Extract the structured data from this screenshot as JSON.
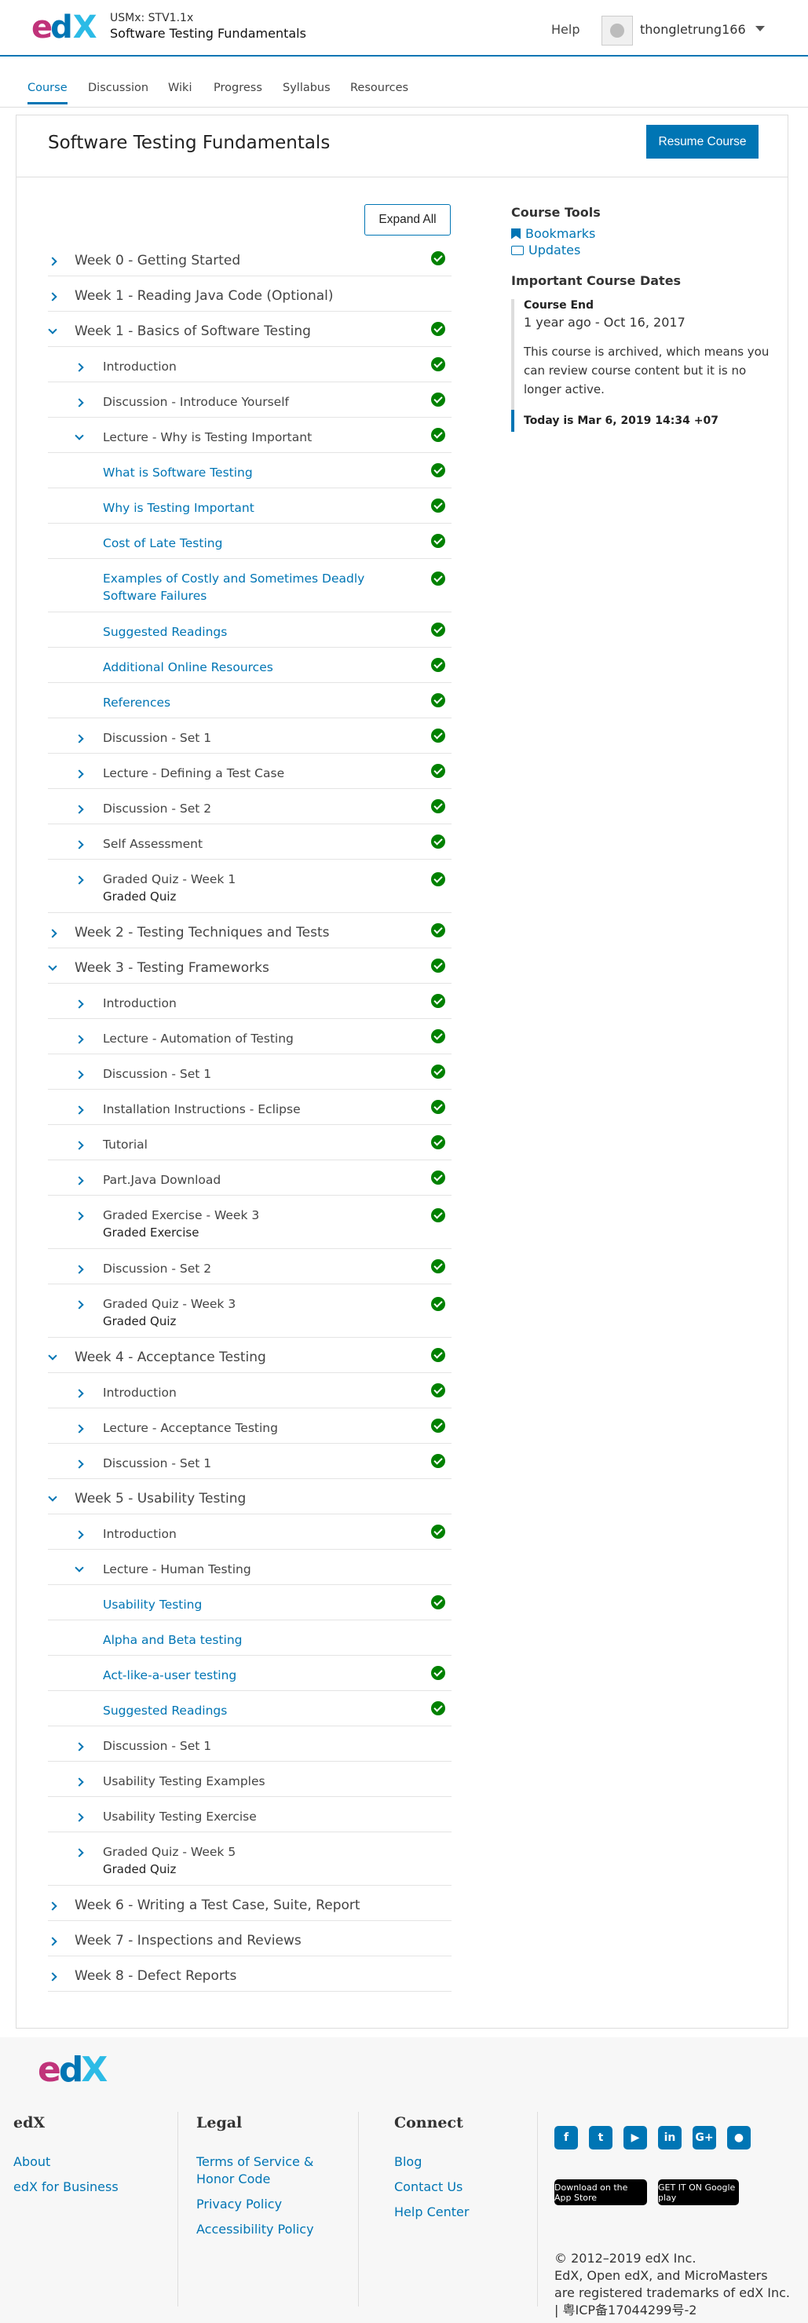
{
  "header": {
    "course_org": "USMx: STV1.1x",
    "course_title": "Software Testing Fundamentals",
    "help": "Help",
    "username": "thongletrung166"
  },
  "tabs": [
    "Course",
    "Discussion",
    "Wiki",
    "Progress",
    "Syllabus",
    "Resources"
  ],
  "main": {
    "title": "Software Testing Fundamentals",
    "resume": "Resume Course",
    "expand_all": "Expand All"
  },
  "outline": [
    {
      "text": "Week 0 - Getting Started",
      "level": 0,
      "icon": "chevron-right",
      "link": false,
      "checked": true
    },
    {
      "text": "Week 1 - Reading Java Code (Optional)",
      "level": 0,
      "icon": "chevron-right",
      "link": false,
      "checked": false
    },
    {
      "text": "Week 1 - Basics of Software Testing",
      "level": 0,
      "icon": "chevron-down",
      "link": false,
      "checked": true
    },
    {
      "text": "Introduction",
      "level": 1,
      "icon": "chevron-right",
      "link": false,
      "checked": true
    },
    {
      "text": "Discussion - Introduce Yourself",
      "level": 1,
      "icon": "chevron-right",
      "link": false,
      "checked": true
    },
    {
      "text": "Lecture - Why is Testing Important",
      "level": 1,
      "icon": "chevron-down",
      "link": false,
      "checked": true
    },
    {
      "text": "What is Software Testing",
      "level": 2,
      "icon": "",
      "link": true,
      "checked": true
    },
    {
      "text": "Why is Testing Important",
      "level": 2,
      "icon": "",
      "link": true,
      "checked": true
    },
    {
      "text": "Cost of Late Testing",
      "level": 2,
      "icon": "",
      "link": true,
      "checked": true
    },
    {
      "text": "Examples of Costly and Sometimes Deadly Software Failures",
      "level": 2,
      "icon": "",
      "link": true,
      "checked": true
    },
    {
      "text": "Suggested Readings",
      "level": 2,
      "icon": "",
      "link": true,
      "checked": true
    },
    {
      "text": "Additional Online Resources",
      "level": 2,
      "icon": "",
      "link": true,
      "checked": true
    },
    {
      "text": "References",
      "level": 2,
      "icon": "",
      "link": true,
      "checked": true
    },
    {
      "text": "Discussion - Set 1",
      "level": 1,
      "icon": "chevron-right",
      "link": false,
      "checked": true
    },
    {
      "text": "Lecture - Defining a Test Case",
      "level": 1,
      "icon": "chevron-right",
      "link": false,
      "checked": true
    },
    {
      "text": "Discussion - Set 2",
      "level": 1,
      "icon": "chevron-right",
      "link": false,
      "checked": true
    },
    {
      "text": "Self Assessment",
      "level": 1,
      "icon": "chevron-right",
      "link": false,
      "checked": true
    },
    {
      "text": "Graded Quiz - Week 1",
      "sub": "Graded Quiz",
      "level": 1,
      "icon": "chevron-right",
      "link": false,
      "checked": true
    },
    {
      "text": "Week 2 - Testing Techniques and Tests",
      "level": 0,
      "icon": "chevron-right",
      "link": false,
      "checked": true
    },
    {
      "text": "Week 3 - Testing Frameworks",
      "level": 0,
      "icon": "chevron-down",
      "link": false,
      "checked": true
    },
    {
      "text": "Introduction",
      "level": 1,
      "icon": "chevron-right",
      "link": false,
      "checked": true
    },
    {
      "text": "Lecture - Automation of Testing",
      "level": 1,
      "icon": "chevron-right",
      "link": false,
      "checked": true
    },
    {
      "text": "Discussion - Set 1",
      "level": 1,
      "icon": "chevron-right",
      "link": false,
      "checked": true
    },
    {
      "text": "Installation Instructions - Eclipse",
      "level": 1,
      "icon": "chevron-right",
      "link": false,
      "checked": true
    },
    {
      "text": "Tutorial",
      "level": 1,
      "icon": "chevron-right",
      "link": false,
      "checked": true
    },
    {
      "text": "Part.Java Download",
      "level": 1,
      "icon": "chevron-right",
      "link": false,
      "checked": true
    },
    {
      "text": "Graded Exercise - Week 3",
      "sub": "Graded Exercise",
      "level": 1,
      "icon": "chevron-right",
      "link": false,
      "checked": true
    },
    {
      "text": "Discussion - Set 2",
      "level": 1,
      "icon": "chevron-right",
      "link": false,
      "checked": true
    },
    {
      "text": "Graded Quiz - Week 3",
      "sub": "Graded Quiz",
      "level": 1,
      "icon": "chevron-right",
      "link": false,
      "checked": true
    },
    {
      "text": "Week 4 - Acceptance Testing",
      "level": 0,
      "icon": "chevron-down",
      "link": false,
      "checked": true
    },
    {
      "text": "Introduction",
      "level": 1,
      "icon": "chevron-right",
      "link": false,
      "checked": true
    },
    {
      "text": "Lecture - Acceptance Testing",
      "level": 1,
      "icon": "chevron-right",
      "link": false,
      "checked": true
    },
    {
      "text": "Discussion - Set 1",
      "level": 1,
      "icon": "chevron-right",
      "link": false,
      "checked": true
    },
    {
      "text": "Week 5 - Usability Testing",
      "level": 0,
      "icon": "chevron-down",
      "link": false,
      "checked": false
    },
    {
      "text": "Introduction",
      "level": 1,
      "icon": "chevron-right",
      "link": false,
      "checked": true
    },
    {
      "text": "Lecture - Human Testing",
      "level": 1,
      "icon": "chevron-down",
      "link": false,
      "checked": false
    },
    {
      "text": "Usability Testing",
      "level": 2,
      "icon": "",
      "link": true,
      "checked": true
    },
    {
      "text": "Alpha and Beta testing",
      "level": 2,
      "icon": "",
      "link": true,
      "checked": false
    },
    {
      "text": "Act-like-a-user testing",
      "level": 2,
      "icon": "",
      "link": true,
      "checked": true
    },
    {
      "text": "Suggested Readings",
      "level": 2,
      "icon": "",
      "link": true,
      "checked": true
    },
    {
      "text": "Discussion - Set 1",
      "level": 1,
      "icon": "chevron-right",
      "link": false,
      "checked": false
    },
    {
      "text": "Usability Testing Examples",
      "level": 1,
      "icon": "chevron-right",
      "link": false,
      "checked": false
    },
    {
      "text": "Usability Testing Exercise",
      "level": 1,
      "icon": "chevron-right",
      "link": false,
      "checked": false
    },
    {
      "text": "Graded Quiz - Week 5",
      "sub": "Graded Quiz",
      "level": 1,
      "icon": "chevron-right",
      "link": false,
      "checked": false
    },
    {
      "text": "Week 6 - Writing a Test Case, Suite, Report",
      "level": 0,
      "icon": "chevron-right",
      "link": false,
      "checked": false
    },
    {
      "text": "Week 7 - Inspections and Reviews",
      "level": 0,
      "icon": "chevron-right",
      "link": false,
      "checked": false
    },
    {
      "text": "Week 8 - Defect Reports",
      "level": 0,
      "icon": "chevron-right",
      "link": false,
      "checked": false
    }
  ],
  "sidebar": {
    "tools_title": "Course Tools",
    "bookmarks": "Bookmarks",
    "updates": "Updates",
    "dates_title": "Important Course Dates",
    "course_end_label": "Course End",
    "course_end_date": "1 year ago - Oct 16, 2017",
    "archived_note": "This course is archived, which means you can review course content but it is no longer active.",
    "today": "Today is Mar 6, 2019 14:34 +07"
  },
  "footer": {
    "edx_heading": "edX",
    "edx_links": [
      "About",
      "edX for Business"
    ],
    "legal_heading": "Legal",
    "legal_links": [
      "Terms of Service & Honor Code",
      "Privacy Policy",
      "Accessibility Policy"
    ],
    "connect_heading": "Connect",
    "connect_links": [
      "Blog",
      "Contact Us",
      "Help Center"
    ],
    "social_icons": [
      "facebook-icon",
      "twitter-icon",
      "youtube-icon",
      "linkedin-icon",
      "google-plus-icon",
      "reddit-icon"
    ],
    "app_store": "Download on the App Store",
    "google_play": "GET IT ON Google play",
    "copyright": "© 2012–2019 edX Inc.",
    "trademark": "EdX, Open edX, and MicroMasters are registered trademarks of edX Inc. | 粤ICP备17044299号-2"
  },
  "colors": {
    "accent": "#0075b4",
    "check": "#008100",
    "logo_e": "#c0337a",
    "logo_x": "#2cbbe6"
  }
}
